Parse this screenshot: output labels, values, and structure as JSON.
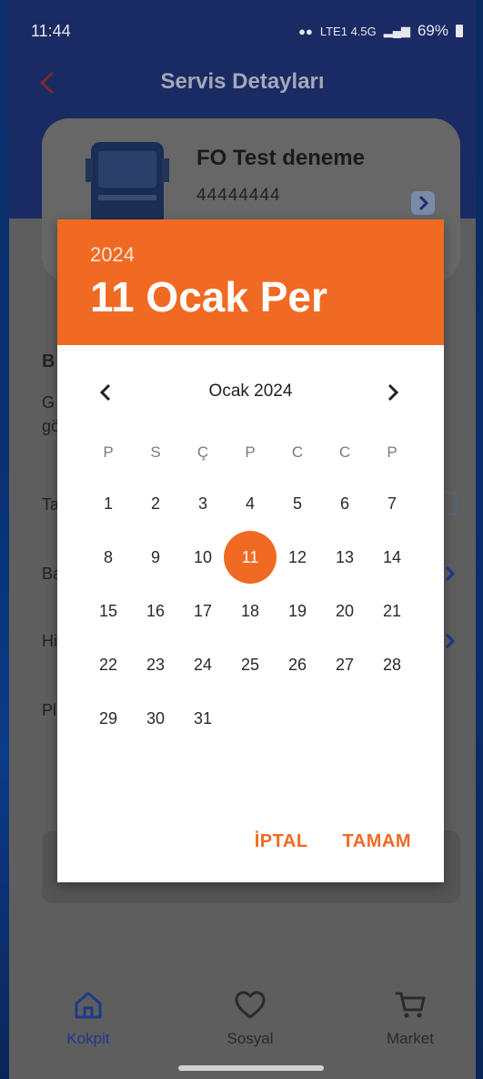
{
  "status_bar": {
    "time": "11:44",
    "network": "LTE1 4.5G",
    "battery": "69%"
  },
  "app_bar": {
    "title": "Servis Detayları"
  },
  "vehicle": {
    "name": "FO Test deneme",
    "plate": "44444444"
  },
  "background_fragments": [
    "B",
    "G",
    "gö",
    "Ta",
    "Ba",
    "Hi",
    "Pl"
  ],
  "date_picker": {
    "year": "2024",
    "selected_date": "11 Ocak Per",
    "month_label": "Ocak 2024",
    "weekdays": [
      "P",
      "S",
      "Ç",
      "P",
      "C",
      "C",
      "P"
    ],
    "days": [
      "1",
      "2",
      "3",
      "4",
      "5",
      "6",
      "7",
      "8",
      "9",
      "10",
      "11",
      "12",
      "13",
      "14",
      "15",
      "16",
      "17",
      "18",
      "19",
      "20",
      "21",
      "22",
      "23",
      "24",
      "25",
      "26",
      "27",
      "28",
      "29",
      "30",
      "31"
    ],
    "selected_day": "11",
    "cancel_label": "İPTAL",
    "ok_label": "TAMAM"
  },
  "bottom_nav": [
    {
      "label": "Kokpit",
      "icon": "home-icon"
    },
    {
      "label": "Sosyal",
      "icon": "heart-icon"
    },
    {
      "label": "Market",
      "icon": "cart-icon"
    }
  ],
  "colors": {
    "accent": "#f06a23",
    "app_bar": "#1a2a63",
    "nav_active": "#1c3a8c"
  }
}
